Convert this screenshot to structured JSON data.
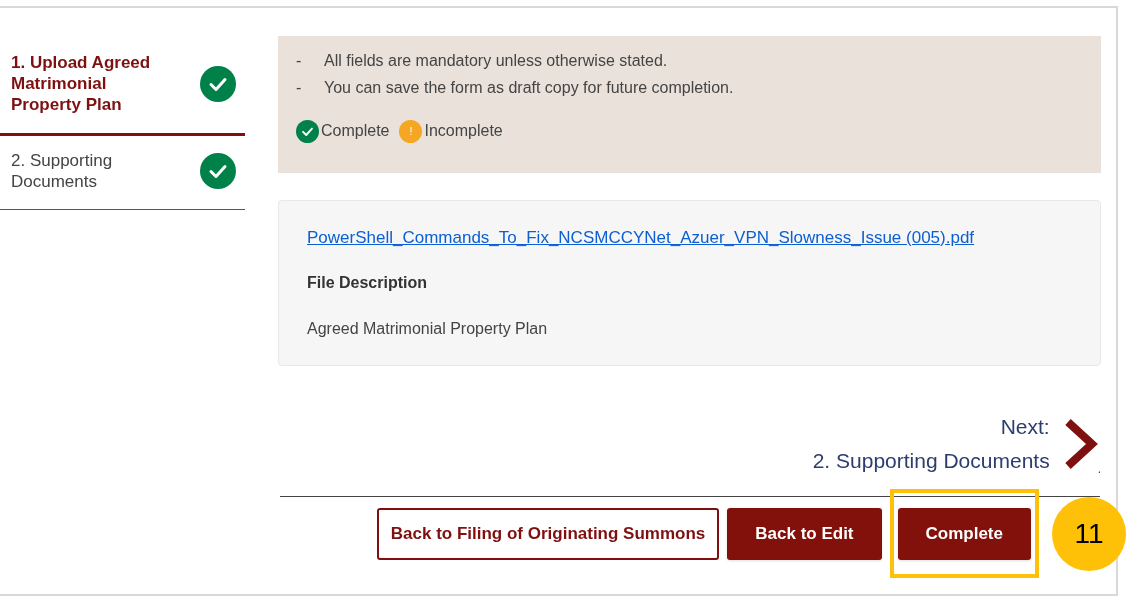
{
  "steps": [
    {
      "label": "1. Upload Agreed Matrimonial Property Plan",
      "selected": true,
      "complete": true
    },
    {
      "label": "2. Supporting Documents",
      "selected": false,
      "complete": true
    }
  ],
  "notes": [
    "All fields are mandatory unless otherwise stated.",
    "You can save the form as draft copy for future completion."
  ],
  "note_marker": "-",
  "legend": [
    {
      "kind": "complete",
      "label": "Complete"
    },
    {
      "kind": "incomplete",
      "label": "Incomplete",
      "icon_text": "!"
    }
  ],
  "file": {
    "link": "PowerShell_Commands_To_Fix_NCSMCCYNet_Azuer_VPN_Slowness_Issue (005).pdf",
    "description_label": "File Description",
    "description": "Agreed Matrimonial Property Plan"
  },
  "next": {
    "label": "Next:",
    "target": "2. Supporting Documents",
    "trailing": "."
  },
  "buttons": [
    {
      "kind": "outline",
      "label": "Back to Filing of Originating Summons",
      "highlighted": false
    },
    {
      "kind": "filled",
      "label": "Back to Edit",
      "highlighted": false
    },
    {
      "kind": "filled",
      "label": "Complete",
      "highlighted": true
    }
  ],
  "callout": "11"
}
